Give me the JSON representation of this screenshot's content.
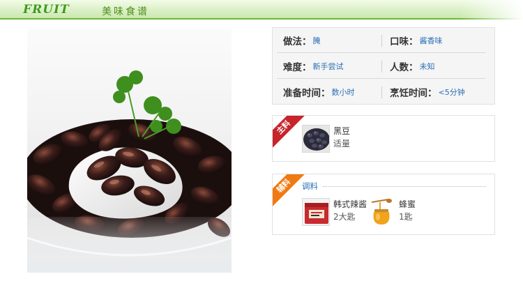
{
  "header": {
    "brand_word": "FRUIT",
    "title": "美味食谱"
  },
  "recipe_photo": {
    "alt": "黑豆"
  },
  "info": {
    "rows": [
      [
        {
          "label": "做法：",
          "value": "腌"
        },
        {
          "label": "口味：",
          "value": "酱香味"
        }
      ],
      [
        {
          "label": "难度：",
          "value": "新手尝试"
        },
        {
          "label": "人数：",
          "value": "未知"
        }
      ],
      [
        {
          "label": "准备时间：",
          "value": "数小时"
        },
        {
          "label": "烹饪时间：",
          "value": "<5分钟"
        }
      ]
    ]
  },
  "main_ingredients": {
    "tag": "主料",
    "items": [
      {
        "name": "黑豆",
        "amount": "适量",
        "icon": "black-beans-thumbnail"
      }
    ]
  },
  "aux_ingredients": {
    "tag": "辅料",
    "group_label": "调料",
    "items": [
      {
        "name": "韩式辣酱",
        "amount": "2大匙",
        "icon": "chili-paste-thumbnail"
      },
      {
        "name": "蜂蜜",
        "amount": "1匙",
        "icon": "honey-jar-thumbnail"
      }
    ]
  },
  "colors": {
    "header_green": "#6cb83b",
    "brand_green": "#3f9a1a",
    "link_blue": "#2a6fb5",
    "ribbon_red": "#c8242c",
    "ribbon_orange": "#f07a12"
  }
}
